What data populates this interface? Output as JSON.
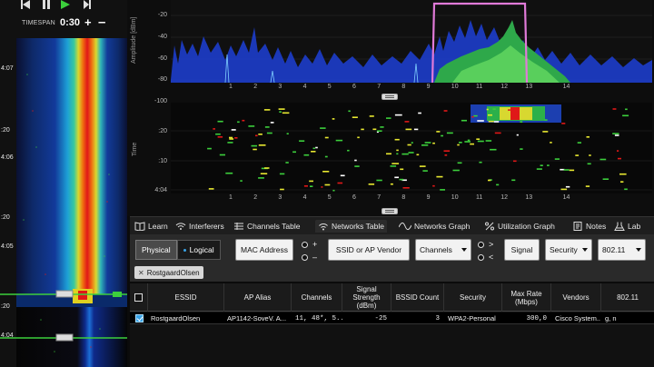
{
  "transport": {
    "rewind_icon": "skip-back-icon",
    "pause_icon": "pause-icon",
    "play_icon": "play-icon"
  },
  "timespan": {
    "label": "TIMESPAN",
    "value": "0:30",
    "plus": "+",
    "minus": "–"
  },
  "waterfall_ticks": [
    "4:07",
    ":20",
    "4:06",
    ":20",
    "4:05",
    ":20",
    "4:04"
  ],
  "spectrum": {
    "y_axis_title": "Amplitude [dBm]",
    "y_ticks": [
      "-20",
      "-40",
      "-60",
      "-80",
      "-100"
    ],
    "x_ticks": [
      "1",
      "2",
      "3",
      "4",
      "5",
      "6",
      "7",
      "8",
      "9",
      "10",
      "11",
      "12",
      "13",
      "14"
    ]
  },
  "timeline": {
    "y_axis_title": "Time",
    "y_ticks": [
      ":20",
      ":10",
      "4:04"
    ],
    "x_ticks": [
      "1",
      "2",
      "3",
      "4",
      "5",
      "6",
      "7",
      "8",
      "9",
      "10",
      "11",
      "12",
      "13",
      "14"
    ]
  },
  "tabs": [
    {
      "label": "Learn",
      "icon": "book-icon"
    },
    {
      "label": "Interferers",
      "icon": "signal-waves-icon"
    },
    {
      "label": "Channels Table",
      "icon": "table-icon"
    },
    {
      "label": "Networks Table",
      "icon": "wifi-icon",
      "active": true
    },
    {
      "label": "Networks Graph",
      "icon": "wave-graph-icon"
    },
    {
      "label": "Utilization Graph",
      "icon": "percent-icon"
    },
    {
      "label": "Notes",
      "icon": "notes-icon"
    },
    {
      "label": "Lab",
      "icon": "lab-icon"
    }
  ],
  "filters": {
    "physical": "Physical",
    "logical": "Logical",
    "mac_address": "MAC Address",
    "plus": "+",
    "minus": "–",
    "ssid_vendor": "SSID or AP Vendor",
    "channels": "Channels",
    "greater": ">",
    "less": "<",
    "signal": "Signal",
    "security": "Security",
    "standard": "802.11"
  },
  "chip": {
    "label": "RostgaardOlsen",
    "close": "✕"
  },
  "table": {
    "columns": [
      "ESSID",
      "AP Alias",
      "Channels",
      "Signal Strength (dBm)",
      "BSSID Count",
      "Security",
      "Max Rate (Mbps)",
      "Vendors",
      "802.11"
    ],
    "rows": [
      [
        "RostgaardOlsen",
        "AP1142-SoveV. A...",
        "11, 48*, 5...",
        "-25",
        "3",
        "WPA2-Personal",
        "300,0",
        "Cisco System...",
        "g, n"
      ]
    ]
  },
  "colors": {
    "accent_green": "#3ccf3c",
    "wifi_pink": "#e07ad8",
    "spectrum_blue": "#1d3fd6",
    "selected_check": "#39a2e6"
  }
}
